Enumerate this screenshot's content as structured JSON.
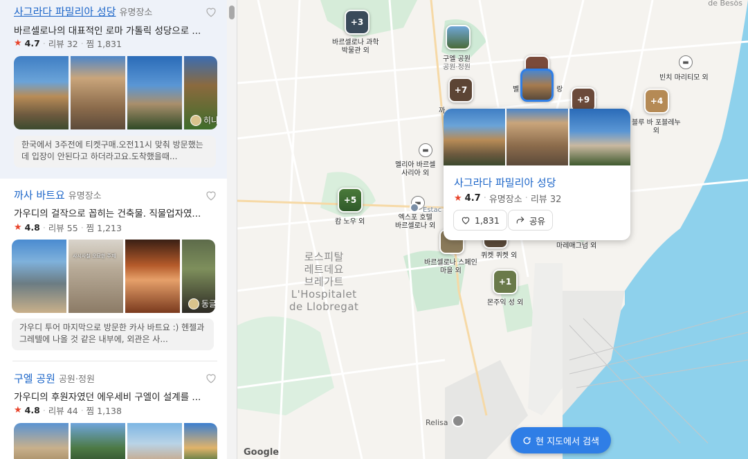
{
  "list": {
    "places": [
      {
        "title": "사그라다 파밀리아 성당",
        "category": "유명장소",
        "description": "바르셀로나의 대표적인 로마 가톨릭 성당으로 ...",
        "rating": "4.7",
        "reviews": "리뷰 32",
        "saves": "찜 1,831",
        "photo_tag": "히나",
        "review_snippet": "한국에서 3주전에 티켓구매.오전11시 맞춰 방문했는데 입장이 안된다고 하더라고요.도착했을때..."
      },
      {
        "title": "까사 바트요",
        "category": "유명장소",
        "description": "가우디의 걸작으로 꼽히는 건축물. 직물업자였...",
        "rating": "4.8",
        "reviews": "리뷰 55",
        "saves": "찜 1,213",
        "photo_tag": "동글",
        "photo_caption": "사시사철 오묘한 주제",
        "review_snippet": "가우디 투어 마지막으로 방문한 카사 바트요 :) 헨젤과 그레텔에 나올 것 같은 내부에, 외관은 사..."
      },
      {
        "title": "구엘 공원",
        "category": "공원·정원",
        "description": "가우디의 후원자였던 에우세비 구엘이 설계를 ...",
        "rating": "4.8",
        "reviews": "리뷰 44",
        "saves": "찜 1,138"
      }
    ]
  },
  "map": {
    "corner_label": "de Besòs",
    "district": [
      "로스피탈",
      "레트데요",
      "브레가트",
      "L'Hospitalet",
      "de Llobregat"
    ],
    "labels": {
      "science": [
        "바르셀로나 과학",
        "박물관 외"
      ],
      "guell": [
        "구엘 공원",
        "공원·정원"
      ],
      "bel": "벨",
      "rang": "랑",
      "kka": "까",
      "melia": [
        "멜리아 바르셀",
        "사리아 외"
      ],
      "camp": "캄 노우 외",
      "expo": [
        "엑스포 호텔",
        "바르셀로나 외"
      ],
      "estac": "Estac",
      "spain": [
        "바르셀로나 스페인",
        "마을 외"
      ],
      "quicket": "퀴켓 퀴켓 외",
      "montjuic": "몬주익 성 외",
      "marem": "마레매그넘 외",
      "binch": "빈치 마리티모 외",
      "blue": [
        "블루 바 포블레누",
        "외"
      ],
      "relisa": "Relisa",
      "google": "Google"
    },
    "markers": {
      "science": "+3",
      "p7": "+7",
      "p9": "+9",
      "p4": "+4",
      "p5": "+5",
      "p1": "+1"
    }
  },
  "popup": {
    "title": "사그라다 파밀리아 성당",
    "rating": "4.7",
    "category": "유명장소",
    "reviews": "리뷰 32",
    "like_count": "1,831",
    "share_label": "공유"
  },
  "search_here_label": "현 지도에서 검색",
  "colors": {
    "accent": "#2f7ee6",
    "title_link": "#1a64c8",
    "star": "#e8432a",
    "water": "#8ed1ec",
    "land": "#f5f3ef",
    "park": "#cfead6"
  }
}
